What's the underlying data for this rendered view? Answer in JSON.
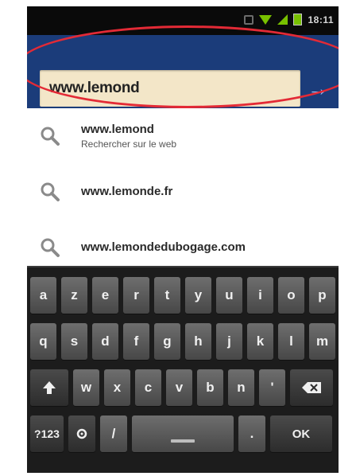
{
  "status_bar": {
    "time": "18:11",
    "icons": [
      "usb-icon",
      "wifi-icon",
      "signal-icon",
      "battery-icon"
    ]
  },
  "search": {
    "url_value": "www.lemond",
    "go_icon": "arrow-right-icon"
  },
  "suggestions": [
    {
      "title": "www.lemond",
      "subtitle": "Rechercher sur le web"
    },
    {
      "title": "www.lemonde.fr",
      "subtitle": ""
    },
    {
      "title": "www.lemondedubogage.com",
      "subtitle": ""
    }
  ],
  "keyboard": {
    "row1": [
      "a",
      "z",
      "e",
      "r",
      "t",
      "y",
      "u",
      "i",
      "o",
      "p"
    ],
    "row2": [
      "q",
      "s",
      "d",
      "f",
      "g",
      "h",
      "j",
      "k",
      "l",
      "m"
    ],
    "row3": [
      "w",
      "x",
      "c",
      "v",
      "b",
      "n",
      "'"
    ],
    "row4": {
      "mode": "?123",
      "settings_icon": "gear-icon",
      "slash": "/",
      "dot": ".",
      "ok": "OK"
    },
    "shift_icon": "shift-up-arrow-icon",
    "backspace_icon": "backspace-icon"
  },
  "colors": {
    "search_bg": "#1b3c7a",
    "url_field_bg": "#f3e6c8",
    "highlight": "#e32a36",
    "key_bg": "#5a5a5a",
    "keyboard_bg": "#1c1c1c"
  }
}
